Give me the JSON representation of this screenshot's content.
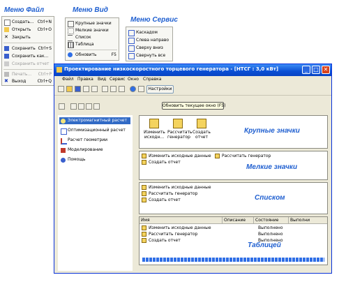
{
  "callouts": {
    "file_menu": "Меню Файл",
    "view_menu": "Меню Вид",
    "service_menu": "Меню Сервис",
    "large_icons": "Крупные значки",
    "small_icons": "Мелкие значки",
    "list": "Списком",
    "table": "Таблицей"
  },
  "file_menu": {
    "items": [
      {
        "label": "Создать...",
        "shortcut": "Ctrl+N",
        "icon": "new-doc-icon"
      },
      {
        "label": "Открыть",
        "shortcut": "Ctrl+O",
        "icon": "open-folder-icon"
      },
      {
        "label": "Закрыть",
        "shortcut": "",
        "icon": "close-icon"
      },
      {
        "label": "Сохранить",
        "shortcut": "Ctrl+S",
        "icon": "save-icon"
      },
      {
        "label": "Сохранить как...",
        "shortcut": "",
        "icon": "save-as-icon"
      },
      {
        "label": "Сохранить отчет",
        "shortcut": "",
        "icon": "report-icon",
        "disabled": true
      },
      {
        "label": "Печать...",
        "shortcut": "Ctrl+P",
        "icon": "print-icon",
        "disabled": true
      },
      {
        "label": "Выход",
        "shortcut": "Ctrl+Q",
        "icon": "exit-icon"
      }
    ]
  },
  "view_menu": {
    "items": [
      {
        "label": "Крупные значки",
        "shortcut": ""
      },
      {
        "label": "Мелкие значки",
        "shortcut": ""
      },
      {
        "label": "Список",
        "shortcut": ""
      },
      {
        "label": "Таблица",
        "shortcut": ""
      },
      {
        "label": "Обновить",
        "shortcut": "F5"
      }
    ]
  },
  "service_menu": {
    "items": [
      {
        "label": "Каскадом"
      },
      {
        "label": "Слева направо"
      },
      {
        "label": "Сверху вниз"
      },
      {
        "label": "Свернуть все"
      }
    ]
  },
  "window": {
    "title": "Проектирование низкоскоростного торцевого генератора - [НТСГ : 3,0 кВт]",
    "menubar": [
      "Файл",
      "Правка",
      "Вид",
      "Сервис",
      "Окно",
      "Справка"
    ],
    "settings_button": "Настройки",
    "refresh_tooltip": "Обновить текущее окно (F5)"
  },
  "nav": {
    "items": [
      {
        "label": "Электромагнитный расчет",
        "selected": true
      },
      {
        "label": "Оптимизационный расчет"
      },
      {
        "label": "Расчет геометрии"
      },
      {
        "label": "Моделирование"
      },
      {
        "label": "Помощь"
      }
    ]
  },
  "large_view": [
    "Изменить исходн...",
    "Рассчитать генератор",
    "Создать отчет"
  ],
  "small_view": [
    "Изменить исходные данные",
    "Рассчитать генератор",
    "Создать отчет"
  ],
  "list_view": [
    "Изменить исходные данные",
    "Рассчитать генератор",
    "Создать отчет"
  ],
  "table_view": {
    "headers": [
      "Имя",
      "Описание",
      "Состояние",
      "Выполни"
    ],
    "rows": [
      {
        "name": "Изменить исходные данные",
        "state": "Выполнено"
      },
      {
        "name": "Рассчитать генератор",
        "state": "Выполнено"
      },
      {
        "name": "Создать отчет",
        "state": "Выполнено"
      }
    ]
  },
  "colors": {
    "accent": "#1f5fd0",
    "titlebar": "#0a4fd4",
    "window_bg": "#ece9d8"
  }
}
